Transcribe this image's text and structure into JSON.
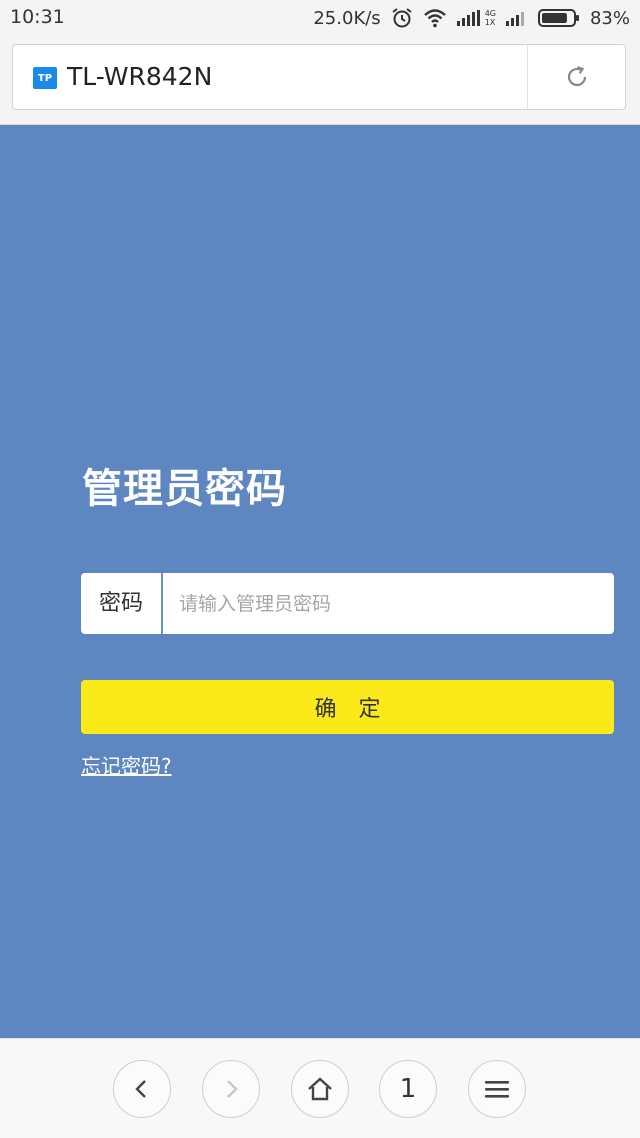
{
  "status_bar": {
    "time": "10:31",
    "net_speed": "25.0K/s",
    "net_4g": "4G",
    "net_1x": "1X",
    "battery": "83%",
    "battery_level_percent": 83
  },
  "browser": {
    "site_title": "TL-WR842N",
    "favicon_text": "TP",
    "favicon_color": "#1a8ae6"
  },
  "login": {
    "title": "管理员密码",
    "password_label": "密码",
    "password_placeholder": "请输入管理员密码",
    "password_value": "",
    "confirm_label": "确定",
    "forgot_link": "忘记密码?"
  },
  "bottom_nav": {
    "tab_count": "1"
  },
  "colors": {
    "background": "#5e86c1",
    "confirm_button": "#fbe91a"
  }
}
